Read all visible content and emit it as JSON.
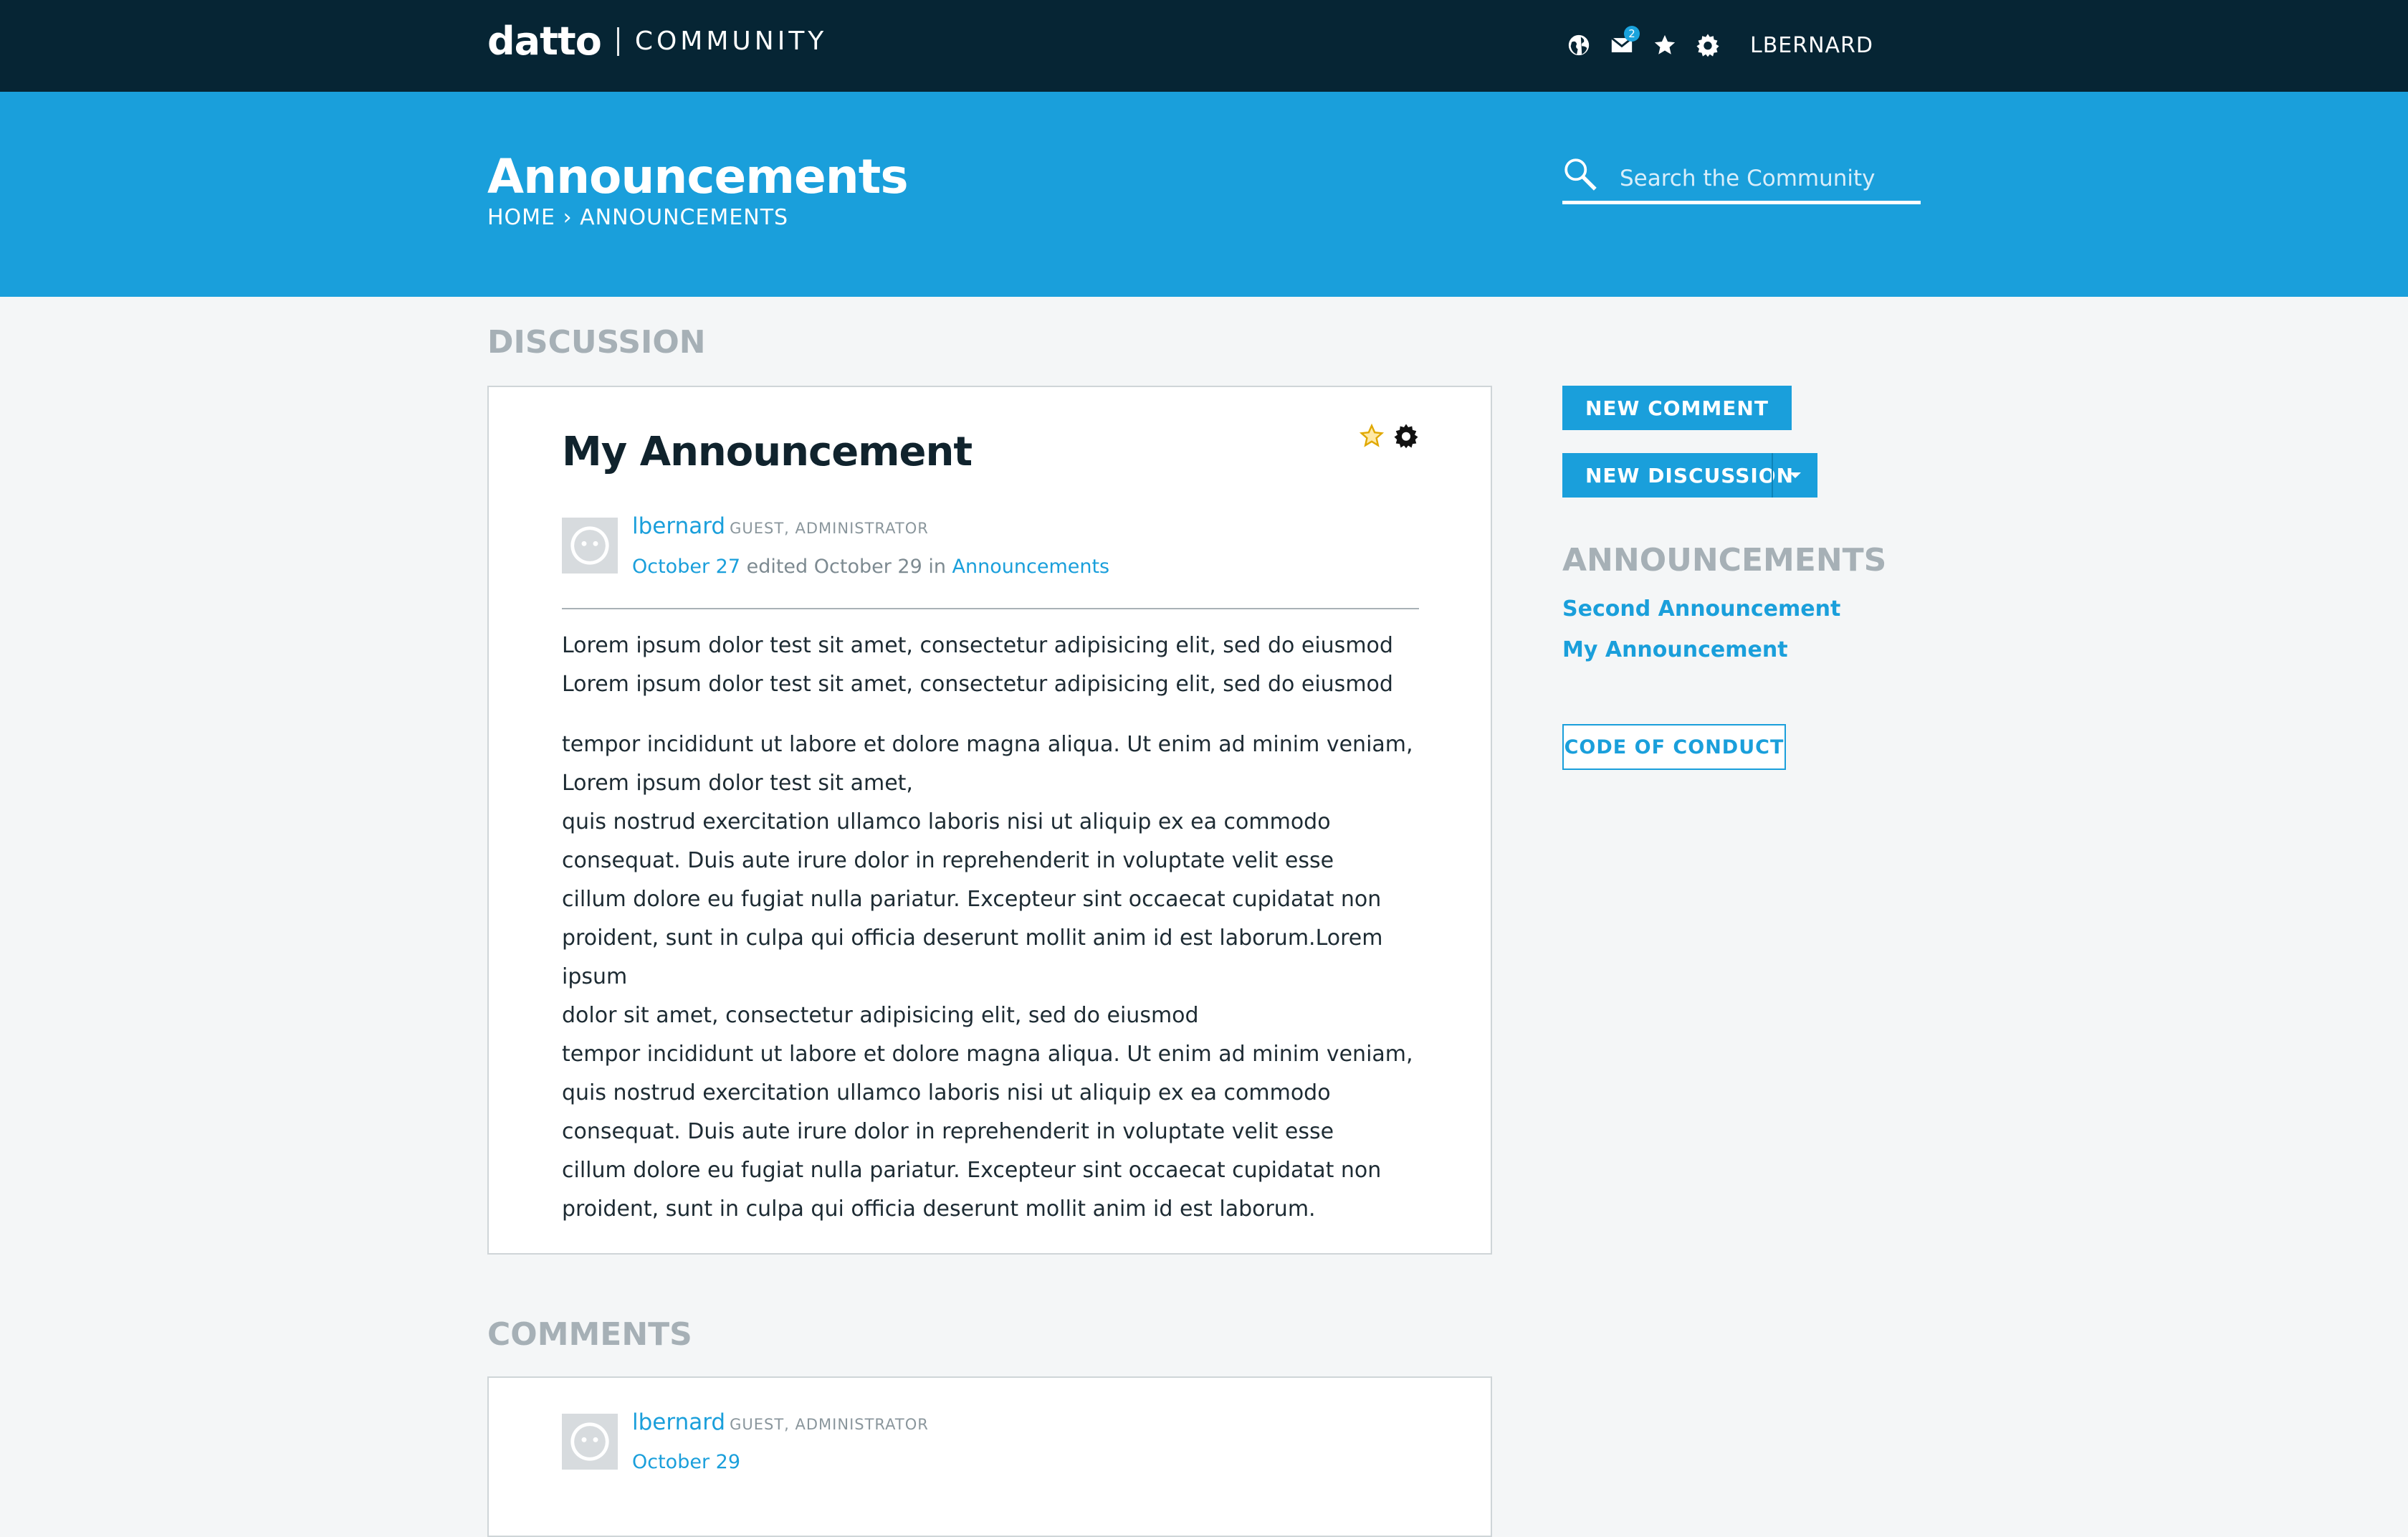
{
  "header": {
    "logo_word": "datto",
    "logo_community": "COMMUNITY",
    "mail_badge": "2",
    "username": "LBERNARD",
    "icons": [
      "globe-icon",
      "mail-icon",
      "star-icon",
      "gear-icon"
    ]
  },
  "hero": {
    "title": "Announcements",
    "breadcrumb_home": "HOME",
    "breadcrumb_sep": "›",
    "breadcrumb_current": "ANNOUNCEMENTS",
    "search_placeholder": "Search the Community"
  },
  "discussion": {
    "heading": "DISCUSSION",
    "title": "My Announcement",
    "author": "lbernard",
    "author_role": "GUEST, ADMINISTRATOR",
    "date": "October 27",
    "edited_text": "edited October 29 in",
    "category": "Announcements",
    "paragraph1": "Lorem ipsum dolor test sit amet, consectetur adipisicing elit, sed do eiusmod Lorem ipsum dolor test sit amet, consectetur adipisicing elit, sed do eiusmod",
    "paragraph2_lines": [
      "tempor incididunt ut labore et dolore magna aliqua. Ut enim ad minim veniam,",
      "Lorem ipsum dolor test sit amet,",
      "quis nostrud exercitation ullamco laboris nisi ut aliquip ex ea commodo",
      "consequat. Duis aute irure dolor in reprehenderit in voluptate velit esse",
      "cillum dolore eu fugiat nulla pariatur. Excepteur sint occaecat cupidatat non",
      "proident, sunt in culpa qui officia deserunt mollit anim id est laborum.Lorem ipsum",
      "dolor sit amet, consectetur adipisicing elit, sed do eiusmod",
      "tempor incididunt ut labore et dolore magna aliqua. Ut enim ad minim veniam,",
      "quis nostrud exercitation ullamco laboris nisi ut aliquip ex ea commodo",
      "consequat. Duis aute irure dolor in reprehenderit in voluptate velit esse",
      "cillum dolore eu fugiat nulla pariatur. Excepteur sint occaecat cupidatat non",
      "proident, sunt in culpa qui officia deserunt mollit anim id est laborum."
    ]
  },
  "comments": {
    "heading": "COMMENTS",
    "items": [
      {
        "author": "lbernard",
        "role": "GUEST, ADMINISTRATOR",
        "date": "October 29"
      }
    ]
  },
  "sidebar": {
    "new_comment": "NEW COMMENT",
    "new_discussion": "NEW DISCUSSION",
    "announcements_heading": "ANNOUNCEMENTS",
    "links": [
      "Second Announcement",
      "My Announcement"
    ],
    "code_of_conduct": "CODE OF CONDUCT"
  },
  "colors": {
    "topbar": "#062534",
    "accent": "#1a9fdb",
    "background": "#f4f6f7",
    "star": "#f2b600"
  }
}
